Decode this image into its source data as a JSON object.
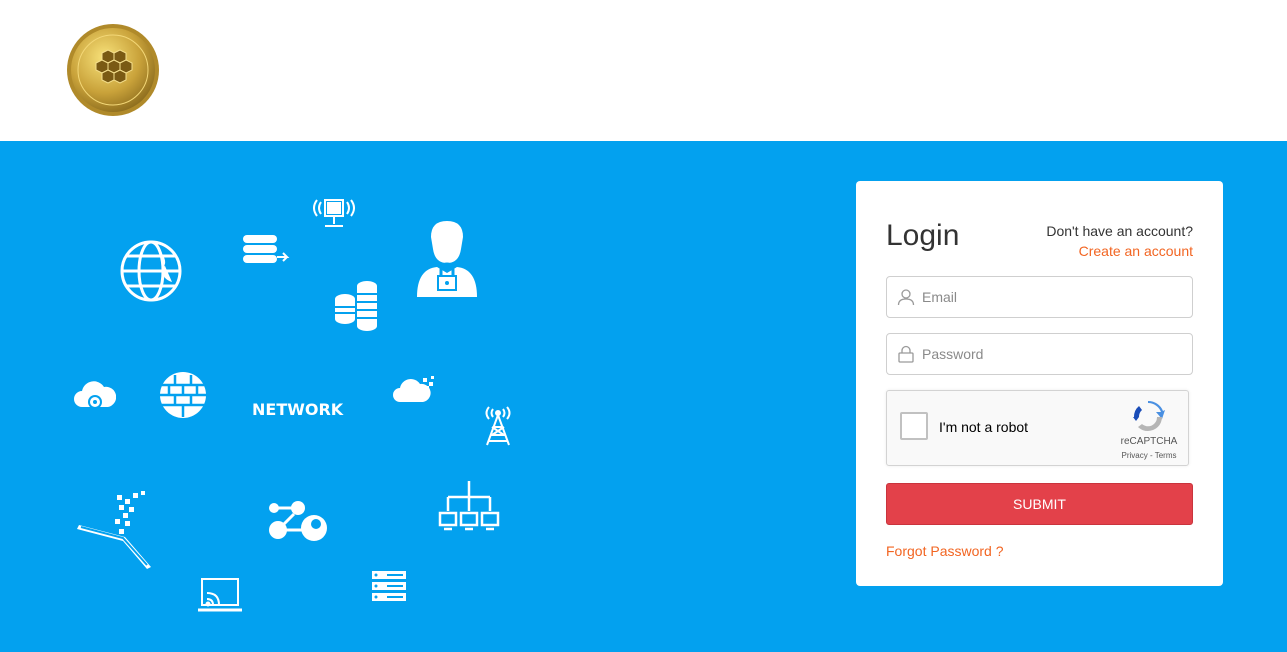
{
  "colors": {
    "hero_bg": "#03a1ef",
    "accent_link": "#f26522",
    "submit_bg": "#e3414a"
  },
  "header": {
    "logo": "gold-coin-logo"
  },
  "hero": {
    "network_text": "NETWORK",
    "icons": [
      "globe-icon",
      "database-transfer-icon",
      "wifi-monitor-icon",
      "user-lock-icon",
      "coin-stack-icon",
      "cloud-settings-icon",
      "firewall-globe-icon",
      "cloud-data-icon",
      "cell-tower-icon",
      "tablet-data-icon",
      "nodes-icon",
      "network-tree-icon",
      "laptop-cast-icon",
      "server-rack-icon"
    ]
  },
  "login": {
    "title": "Login",
    "no_account_text": "Don't have an account?",
    "create_account_link": "Create an account",
    "email_placeholder": "Email",
    "password_placeholder": "Password",
    "recaptcha_label": "I'm not a robot",
    "recaptcha_brand": "reCAPTCHA",
    "recaptcha_links": "Privacy - Terms",
    "submit_label": "SUBMIT",
    "forgot_password_link": "Forgot Password ?"
  }
}
